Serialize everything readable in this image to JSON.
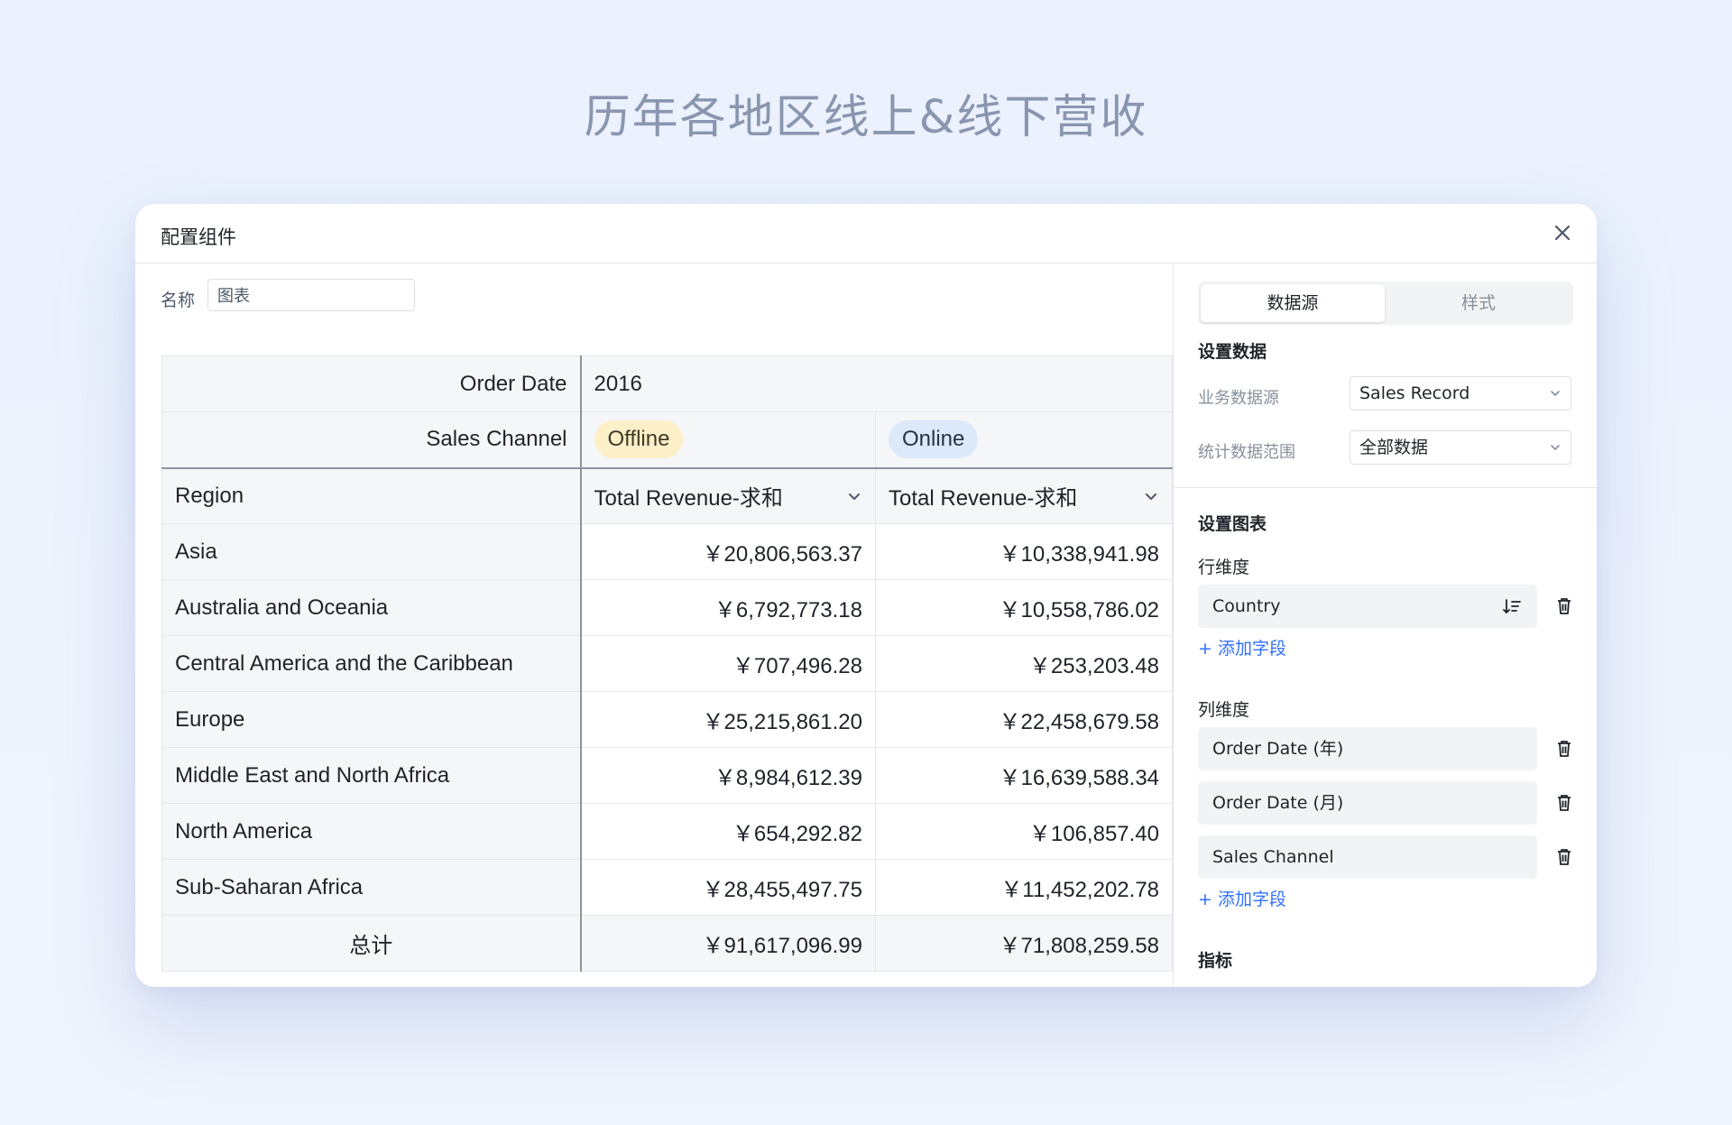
{
  "page": {
    "title": "历年各地区线上&线下营收"
  },
  "modal": {
    "title": "配置组件",
    "name_label": "名称",
    "name_value": "图表"
  },
  "pivot": {
    "col_dim_1_label": "Order Date",
    "col_dim_1_value": "2016",
    "col_dim_2_label": "Sales Channel",
    "channels": [
      "Offline",
      "Online"
    ],
    "row_dim_label": "Region",
    "measure_label": "Total Revenue-求和",
    "rows": [
      {
        "region": "Asia",
        "offline": "￥20,806,563.37",
        "online": "￥10,338,941.98"
      },
      {
        "region": "Australia and Oceania",
        "offline": "￥6,792,773.18",
        "online": "￥10,558,786.02"
      },
      {
        "region": "Central America and the Caribbean",
        "offline": "￥707,496.28",
        "online": "￥253,203.48"
      },
      {
        "region": "Europe",
        "offline": "￥25,215,861.20",
        "online": "￥22,458,679.58"
      },
      {
        "region": "Middle East and North Africa",
        "offline": "￥8,984,612.39",
        "online": "￥16,639,588.34"
      },
      {
        "region": "North America",
        "offline": "￥654,292.82",
        "online": "￥106,857.40"
      },
      {
        "region": "Sub-Saharan Africa",
        "offline": "￥28,455,497.75",
        "online": "￥11,452,202.78"
      }
    ],
    "total": {
      "label": "总计",
      "offline": "￥91,617,096.99",
      "online": "￥71,808,259.58"
    },
    "colors": {
      "offline_tag": "#fdf0c8",
      "online_tag": "#dbe9fb"
    }
  },
  "panel": {
    "tabs": {
      "data_source": "数据源",
      "style": "样式"
    },
    "data_section": "设置数据",
    "business_source_label": "业务数据源",
    "business_source_value": "Sales Record",
    "scope_label": "统计数据范围",
    "scope_value": "全部数据",
    "chart_section": "设置图表",
    "row_dim_title": "行维度",
    "row_fields": [
      "Country"
    ],
    "add_field": "+ 添加字段",
    "col_dim_title": "列维度",
    "col_fields": [
      "Order Date (年)",
      "Order Date (月)",
      "Sales Channel"
    ],
    "metrics_title": "指标",
    "accent_color": "#3370ff"
  }
}
